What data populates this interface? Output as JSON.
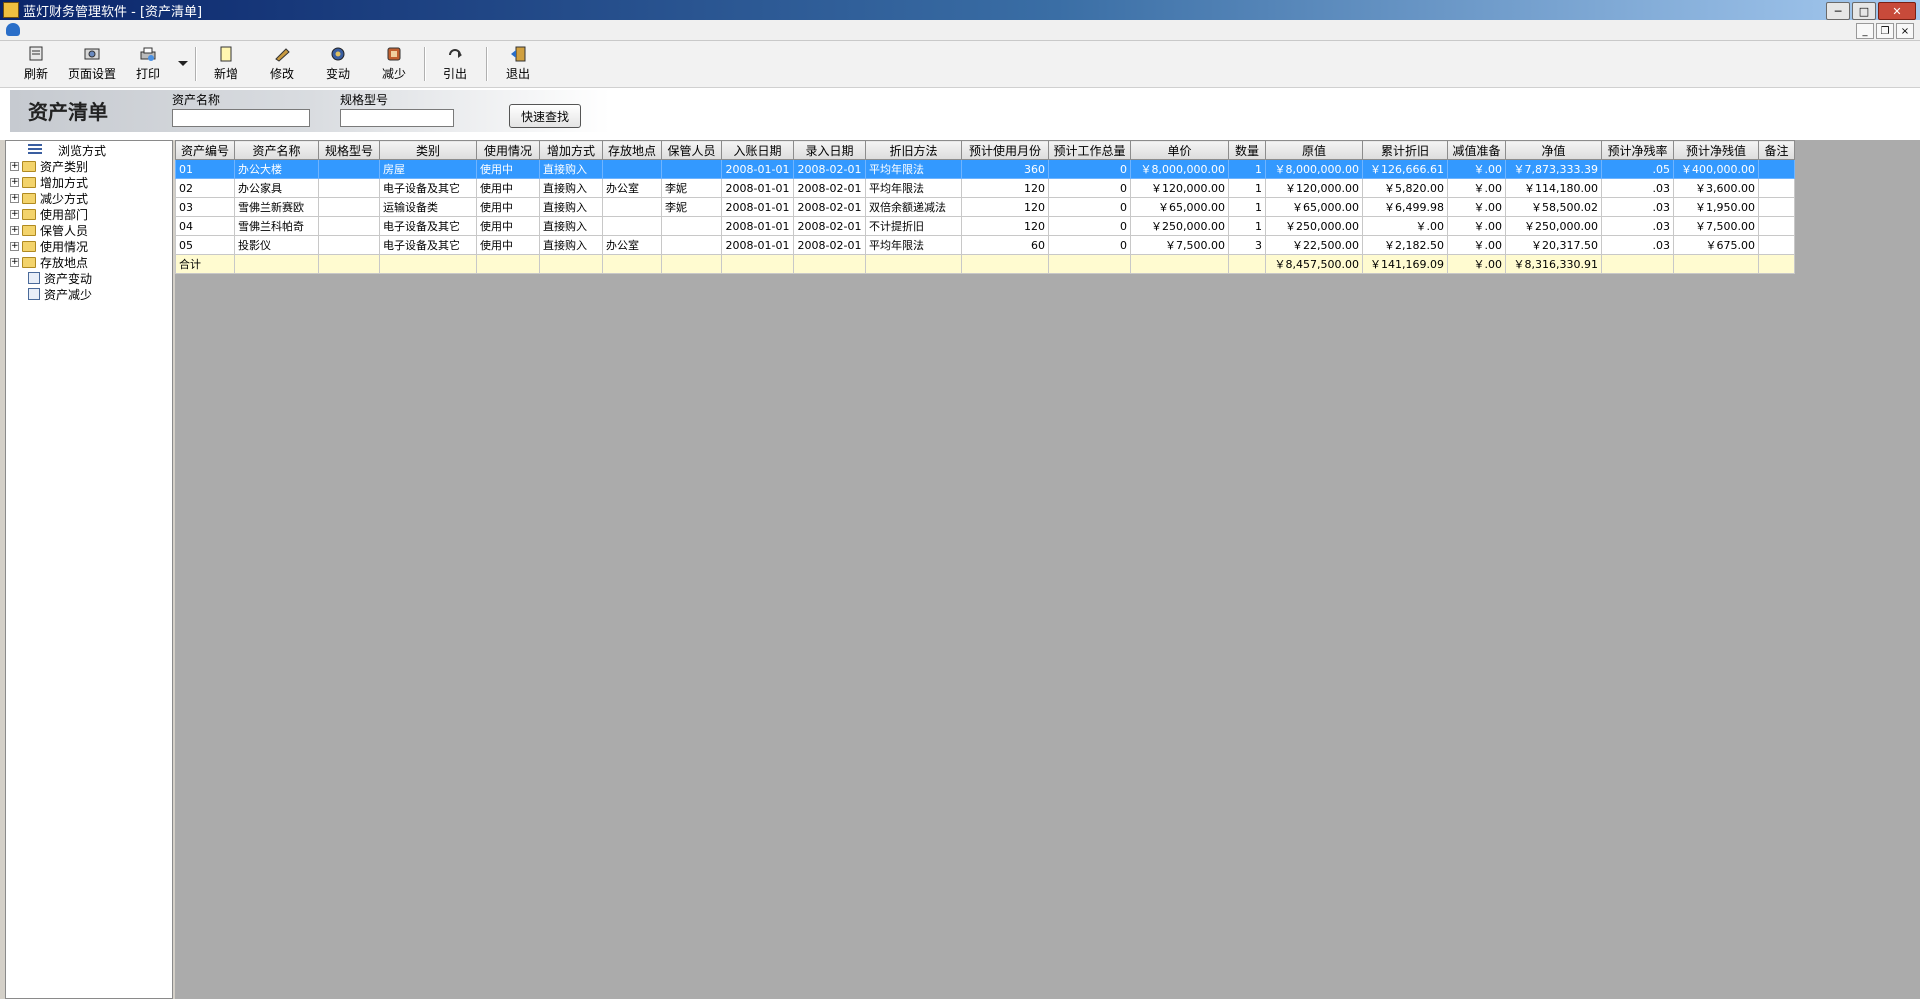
{
  "window": {
    "title": "蓝灯财务管理软件 - [资产清单]",
    "minimize": "─",
    "maximize": "□",
    "close": "✕",
    "mdi_minimize": "_",
    "mdi_restore": "❐",
    "mdi_close": "×"
  },
  "toolbar": {
    "refresh": "刷新",
    "page_setup": "页面设置",
    "print": "打印",
    "add": "新增",
    "edit": "修改",
    "change": "变动",
    "reduce": "减少",
    "export": "引出",
    "exit": "退出"
  },
  "search": {
    "heading": "资产清单",
    "name_label": "资产名称",
    "name_value": "",
    "spec_label": "规格型号",
    "spec_value": "",
    "quick_search": "快速查找"
  },
  "tree": {
    "root": "浏览方式",
    "folders": [
      "资产类别",
      "增加方式",
      "减少方式",
      "使用部门",
      "保管人员",
      "使用情况",
      "存放地点"
    ],
    "leaves": [
      "资产变动",
      "资产减少"
    ]
  },
  "grid": {
    "columns": [
      "资产编号",
      "资产名称",
      "规格型号",
      "类别",
      "使用情况",
      "增加方式",
      "存放地点",
      "保管人员",
      "入账日期",
      "录入日期",
      "折旧方法",
      "预计使用月份",
      "预计工作总量",
      "单价",
      "数量",
      "原值",
      "累计折旧",
      "减值准备",
      "净值",
      "预计净残率",
      "预计净残值",
      "备注"
    ],
    "rows": [
      [
        "01",
        "办公大楼",
        "",
        "房屋",
        "使用中",
        "直接购入",
        "",
        "",
        "2008-01-01",
        "2008-02-01",
        "平均年限法",
        "360",
        "0",
        "￥8,000,000.00",
        "1",
        "￥8,000,000.00",
        "￥126,666.61",
        "￥.00",
        "￥7,873,333.39",
        ".05",
        "￥400,000.00",
        ""
      ],
      [
        "02",
        "办公家具",
        "",
        "电子设备及其它",
        "使用中",
        "直接购入",
        "办公室",
        "李妮",
        "2008-01-01",
        "2008-02-01",
        "平均年限法",
        "120",
        "0",
        "￥120,000.00",
        "1",
        "￥120,000.00",
        "￥5,820.00",
        "￥.00",
        "￥114,180.00",
        ".03",
        "￥3,600.00",
        ""
      ],
      [
        "03",
        "雪佛兰新赛欧",
        "",
        "运输设备类",
        "使用中",
        "直接购入",
        "",
        "李妮",
        "2008-01-01",
        "2008-02-01",
        "双倍余额递减法",
        "120",
        "0",
        "￥65,000.00",
        "1",
        "￥65,000.00",
        "￥6,499.98",
        "￥.00",
        "￥58,500.02",
        ".03",
        "￥1,950.00",
        ""
      ],
      [
        "04",
        "雪佛兰科帕奇",
        "",
        "电子设备及其它",
        "使用中",
        "直接购入",
        "",
        "",
        "2008-01-01",
        "2008-02-01",
        "不计提折旧",
        "120",
        "0",
        "￥250,000.00",
        "1",
        "￥250,000.00",
        "￥.00",
        "￥.00",
        "￥250,000.00",
        ".03",
        "￥7,500.00",
        ""
      ],
      [
        "05",
        "投影仪",
        "",
        "电子设备及其它",
        "使用中",
        "直接购入",
        "办公室",
        "",
        "2008-01-01",
        "2008-02-01",
        "平均年限法",
        "60",
        "0",
        "￥7,500.00",
        "3",
        "￥22,500.00",
        "￥2,182.50",
        "￥.00",
        "￥20,317.50",
        ".03",
        "￥675.00",
        ""
      ]
    ],
    "total": [
      "合计",
      "",
      "",
      "",
      "",
      "",
      "",
      "",
      "",
      "",
      "",
      "",
      "",
      "",
      "",
      "￥8,457,500.00",
      "￥141,169.09",
      "￥.00",
      "￥8,316,330.91",
      "",
      "",
      ""
    ],
    "selected_row": 0
  }
}
